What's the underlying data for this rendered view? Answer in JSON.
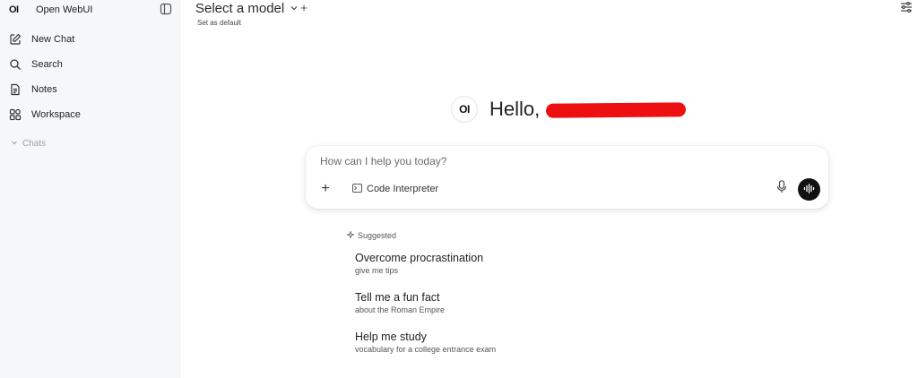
{
  "sidebar": {
    "brand_logo": "OI",
    "brand_name": "Open WebUI",
    "items": [
      {
        "label": "New Chat",
        "icon": "pencil-square-icon"
      },
      {
        "label": "Search",
        "icon": "search-icon"
      },
      {
        "label": "Notes",
        "icon": "notes-icon"
      },
      {
        "label": "Workspace",
        "icon": "workspace-icon"
      }
    ],
    "chats_label": "Chats"
  },
  "header": {
    "model_select_label": "Select a model",
    "set_default_label": "Set as default"
  },
  "greeting": {
    "logo": "OI",
    "text": "Hello,"
  },
  "composer": {
    "placeholder": "How can I help you today?",
    "code_interpreter_label": "Code Interpreter"
  },
  "suggestions": {
    "heading": "Suggested",
    "items": [
      {
        "title": "Overcome procrastination",
        "subtitle": "give me tips"
      },
      {
        "title": "Tell me a fun fact",
        "subtitle": "about the Roman Empire"
      },
      {
        "title": "Help me study",
        "subtitle": "vocabulary for a college entrance exam"
      }
    ]
  },
  "colors": {
    "sidebar_bg": "#f6f7f8",
    "redaction": "#ee1010",
    "voice_button": "#111111"
  }
}
